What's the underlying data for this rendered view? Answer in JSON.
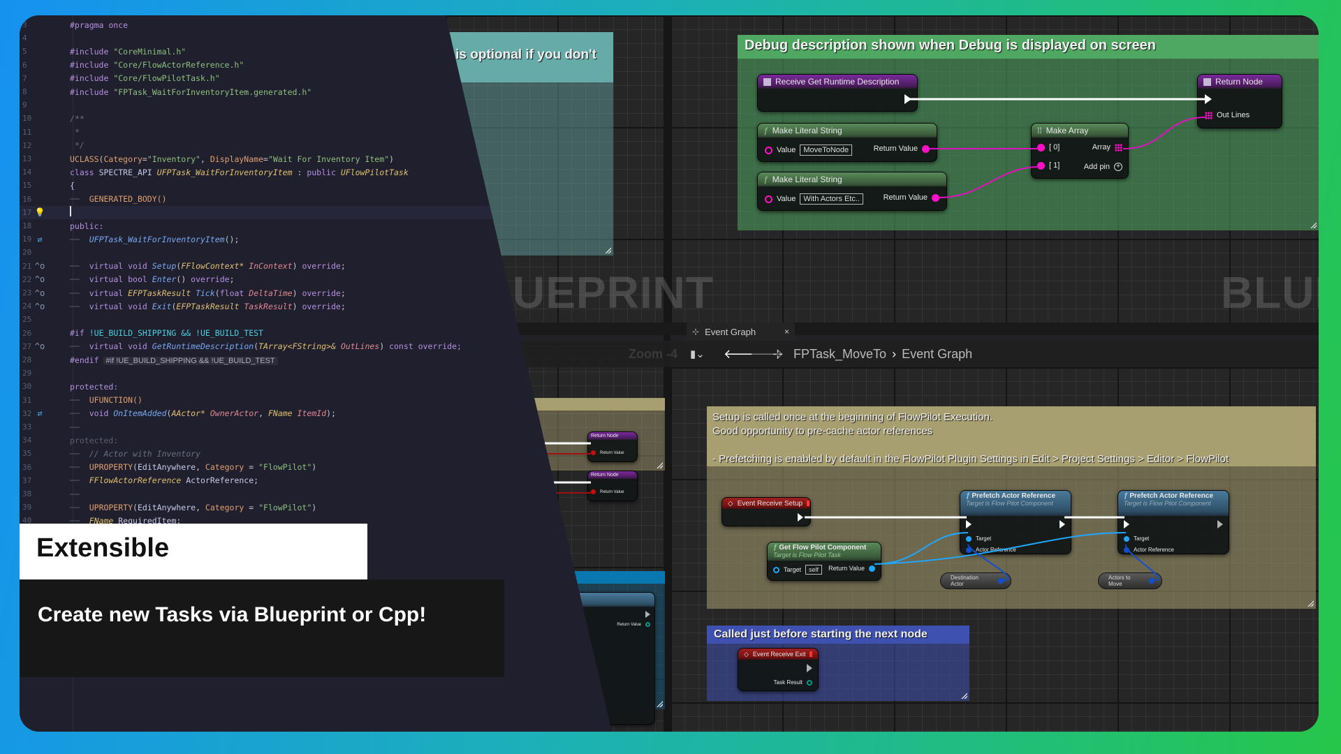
{
  "code_editor": {
    "lines": [
      {
        "n": "3"
      },
      {
        "n": "4"
      },
      {
        "n": "5"
      },
      {
        "n": "6"
      },
      {
        "n": "7"
      },
      {
        "n": "8"
      },
      {
        "n": "9"
      },
      {
        "n": "10"
      },
      {
        "n": "11"
      },
      {
        "n": "12"
      },
      {
        "n": "13"
      },
      {
        "n": "14"
      },
      {
        "n": "15"
      },
      {
        "n": "16"
      },
      {
        "n": "17"
      },
      {
        "n": "18"
      },
      {
        "n": "19"
      },
      {
        "n": "20"
      },
      {
        "n": "21"
      },
      {
        "n": "22"
      },
      {
        "n": "23"
      },
      {
        "n": "24"
      },
      {
        "n": "25"
      },
      {
        "n": "26"
      },
      {
        "n": "27"
      },
      {
        "n": "28"
      },
      {
        "n": "29"
      },
      {
        "n": "30"
      },
      {
        "n": "31"
      },
      {
        "n": "32"
      },
      {
        "n": "33"
      },
      {
        "n": "34"
      },
      {
        "n": "35"
      },
      {
        "n": "36"
      },
      {
        "n": "37"
      },
      {
        "n": "38"
      },
      {
        "n": "39"
      },
      {
        "n": "40"
      }
    ],
    "tokens": {
      "pragma": "#pragma once",
      "include": "#include",
      "inc1": "\"CoreMinimal.h\"",
      "inc2": "\"Core/FlowActorReference.h\"",
      "inc3": "\"Core/FlowPilotTask.h\"",
      "inc4": "\"FPTask_WaitForInventoryItem.generated.h\"",
      "doc_open": "/**",
      "doc_mid": " *",
      "doc_close": " */",
      "uclass": "UCLASS",
      "uclass_args_cat": "Category",
      "uclass_val_cat": "\"Inventory\"",
      "uclass_args_dn": "DisplayName",
      "uclass_val_dn": "\"Wait For Inventory Item\"",
      "class_kw": "class",
      "api": "SPECTRE_API",
      "class_name": "UFPTask_WaitForInventoryItem",
      "public_kw": "public",
      "base_class": "UFlowPilotTask",
      "brace": "{",
      "generated_body": "GENERATED_BODY()",
      "public_label": "public:",
      "ctor": "UFPTask_WaitForInventoryItem",
      "virtual": "virtual",
      "void": "void",
      "bool": "bool",
      "override": "override",
      "setup": "Setup",
      "ctx_type": "FFlowContext*",
      "ctx_param": "InContext",
      "enter": "Enter",
      "result_type": "EFPTaskResult",
      "tick": "Tick",
      "float": "float",
      "delta": "DeltaTime",
      "exit": "Exit",
      "task_result": "TaskResult",
      "if_line": "#if",
      "if_cond": "!UE_BUILD_SHIPPING && !UE_BUILD_TEST",
      "get_desc": "GetRuntimeDescription",
      "tarray": "TArray<FString>&",
      "outlines": "OutLines",
      "const_override": "const override;",
      "endif": "#endif",
      "endif_hint": "#if !UE_BUILD_SHIPPING && !UE_BUILD_TEST",
      "protected_label": "protected:",
      "ufunction": "UFUNCTION()",
      "on_item_added": "OnItemAdded",
      "aactor": "AActor*",
      "owner_actor": "OwnerActor",
      "fname": "FName",
      "item_id": "ItemId",
      "protected_dim": "protected:",
      "comment_actor": "// Actor with Inventory",
      "uproperty": "UPROPERTY",
      "edit_anywhere": "EditAnywhere",
      "category": "Category",
      "flowpilot_str": "\"FlowPilot\"",
      "actor_ref_type": "FFlowActorReference",
      "actor_ref_name": "ActorReference;",
      "required_item": "RequiredItem;"
    }
  },
  "caption": {
    "title": "Extensible",
    "subtitle": "Create new Tasks via Blueprint or Cpp!"
  },
  "blueprint_top": {
    "watermark_left": "UEPRINT",
    "watermark_right": "BLUE",
    "teal_comment": "is optional if you don't",
    "debug_comment": "Debug description shown when Debug is displayed on screen",
    "nodes": {
      "receive_desc": "Receive Get Runtime Description",
      "literal1": {
        "title": "Make Literal String",
        "pin_in": "Value",
        "value": "MoveToNode",
        "pin_out": "Return Value"
      },
      "literal2": {
        "title": "Make Literal String",
        "pin_in": "Value",
        "value": "With Actors Etc..",
        "pin_out": "Return Value"
      },
      "make_array": {
        "title": "Make Array",
        "pin0": "[ 0]",
        "pin1": "[ 1]",
        "out": "Array",
        "add_pin": "Add pin"
      },
      "return_node": {
        "title": "Return Node",
        "pin": "Out Lines"
      }
    }
  },
  "blueprint_bottom": {
    "tab_label": "Event Graph",
    "zoom_label": "Zoom -4",
    "breadcrumb": [
      "FPTask_MoveTo",
      "Event Graph"
    ],
    "setup_comment": [
      "Setup is called once at the beginning of FlowPilot Execution.",
      "Good opportunity to pre-cache actor references",
      "",
      "- Prefetching is enabled by default in the FlowPilot Plugin Settings in Edit > Project Settings > Editor > FlowPilot"
    ],
    "exit_comment": "Called just before starting the next node",
    "nodes": {
      "event_setup": "Event Receive Setup",
      "get_component": {
        "title": "Get Flow Pilot Component",
        "subtitle": "Target is Flow Pilot Task",
        "pin_in": "Target",
        "value": "self",
        "pin_out": "Return Value"
      },
      "prefetch1": {
        "title": "Prefetch Actor Reference",
        "subtitle": "Target is Flow Pilot Component",
        "target": "Target",
        "actor_ref": "Actor Reference"
      },
      "prefetch2": {
        "title": "Prefetch Actor Reference",
        "subtitle": "Target is Flow Pilot Component",
        "target": "Target",
        "actor_ref": "Actor Reference"
      },
      "destination_actor": "Destination Actor",
      "actors_to_move": "Actors to Move",
      "event_exit": {
        "title": "Event Receive Exit",
        "pin": "Task Result"
      },
      "left_return1": {
        "title": "Return Node",
        "pin": "Return Value"
      },
      "left_return2": {
        "title": "Return Node",
        "pin": "Return Value"
      },
      "left_func_pin": "Return Value"
    }
  },
  "colors": {
    "debug_comment": "#4ea862",
    "setup_comment": "#a89f70",
    "exit_comment": "#3f51b0",
    "teal_comment": "#66aba8",
    "code_bg": "#1f1f2e"
  }
}
